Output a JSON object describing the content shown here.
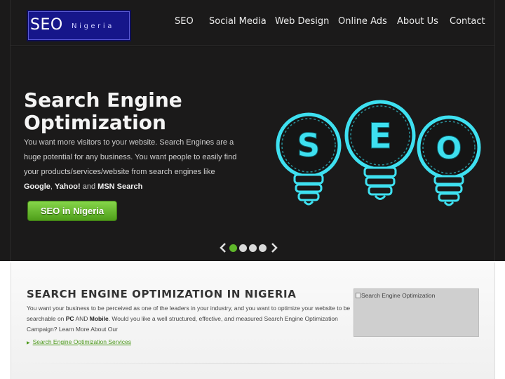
{
  "header": {
    "logo_primary": "SEO",
    "logo_secondary": "Nigeria",
    "nav": [
      "SEO",
      "Social Media",
      "Web Design",
      "Online Ads",
      "About Us",
      "Contact"
    ]
  },
  "hero": {
    "title": "Search Engine Optimization",
    "text_intro": "You want more visitors to your website. Search Engines are a huge potential for any business. You want people to easily find your products/services/website from search engines like ",
    "text_google": "Google",
    "text_comma": ",",
    "text_yahoo": "Yahoo!",
    "text_and": " and ",
    "text_msn": "MSN Search",
    "cta_label": "SEO in Nigeria",
    "bulb_letters": [
      "S",
      "E",
      "O"
    ],
    "slider_active_index": 0,
    "slider_count": 4
  },
  "section": {
    "title": "SEARCH ENGINE OPTIMIZATION IN NIGERIA",
    "text_1": "You want your business to be perceived as one of the leaders in your industry, and you want to optimize your website to be searchable on ",
    "text_pc": "PC",
    "text_and": " AND ",
    "text_mobile": "Mobile",
    "text_2": ". Would you like a well structured, effective, and measured Search Engine Optimization Campaign? Learn More About Our",
    "link_label": "Search Engine Optimization Services",
    "image_alt": "Search Engine Optimization"
  },
  "colors": {
    "accent": "#5fb72a",
    "background_dark": "#1b1a1a",
    "bulb_glow": "#3ee0f0",
    "logo_bg": "#16168a"
  },
  "icons": {
    "slider_prev": "chevron-left-icon",
    "slider_next": "chevron-right-icon",
    "link_bullet": "triangle-right-icon"
  }
}
